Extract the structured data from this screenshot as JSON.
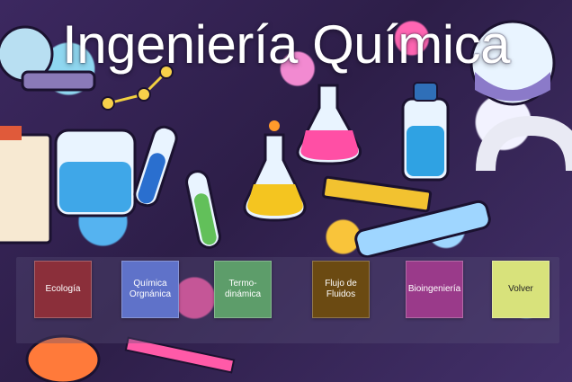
{
  "page": {
    "title": "Ingeniería Química"
  },
  "menu": {
    "buttons": [
      {
        "label": "Ecología",
        "color": "#8b2f3a"
      },
      {
        "label": "Química Orgnánica",
        "color": "#5f72c9"
      },
      {
        "label": "Termo-dinámica",
        "color": "#5d9d6a"
      },
      {
        "label": "Flujo de Fluidos",
        "color": "#6b4a12"
      },
      {
        "label": "Bioingeniería",
        "color": "#9a3a8a"
      },
      {
        "label": "Volver",
        "color": "#d8e27b"
      }
    ]
  },
  "colors": {
    "background": "#3a2559",
    "title_text": "#ffffff"
  }
}
